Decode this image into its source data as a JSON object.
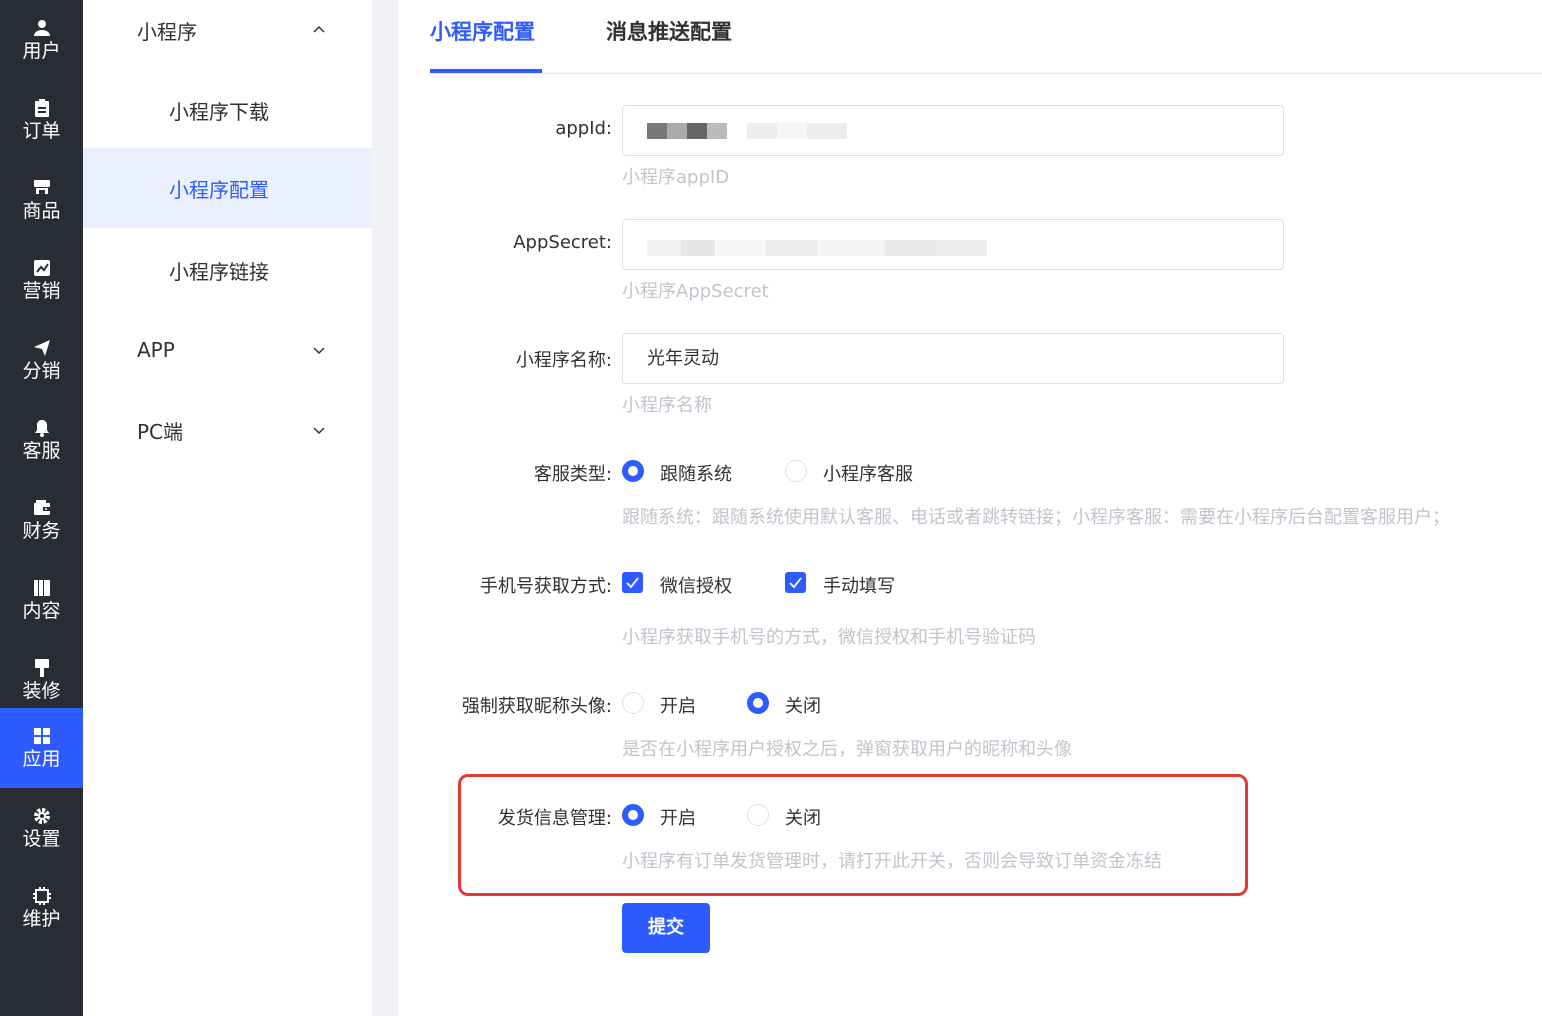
{
  "rail": {
    "items": [
      {
        "label": "用户",
        "icon": "user-icon"
      },
      {
        "label": "订单",
        "icon": "clipboard-icon"
      },
      {
        "label": "商品",
        "icon": "store-icon"
      },
      {
        "label": "营销",
        "icon": "chart-icon"
      },
      {
        "label": "分销",
        "icon": "send-icon"
      },
      {
        "label": "客服",
        "icon": "bell-icon"
      },
      {
        "label": "财务",
        "icon": "wallet-icon"
      },
      {
        "label": "内容",
        "icon": "book-icon"
      },
      {
        "label": "装修",
        "icon": "brush-icon"
      },
      {
        "label": "应用",
        "icon": "apps-icon"
      },
      {
        "label": "设置",
        "icon": "gear-icon"
      },
      {
        "label": "维护",
        "icon": "chip-icon"
      }
    ],
    "active": "应用"
  },
  "submenu": {
    "group_miniprogram": "小程序",
    "item_download": "小程序下载",
    "item_config": "小程序配置",
    "item_link": "小程序链接",
    "group_app": "APP",
    "group_pc": "PC端"
  },
  "tabs": {
    "config": "小程序配置",
    "push": "消息推送配置"
  },
  "form": {
    "appid_label": "appId:",
    "appid_hint": "小程序appID",
    "secret_label": "AppSecret:",
    "secret_hint": "小程序AppSecret",
    "name_label": "小程序名称:",
    "name_value": "光年灵动",
    "name_hint": "小程序名称",
    "service_label": "客服类型:",
    "service_opt1": "跟随系统",
    "service_opt2": "小程序客服",
    "service_hint": "跟随系统：跟随系统使用默认客服、电话或者跳转链接；小程序客服：需要在小程序后台配置客服用户；",
    "phone_label": "手机号获取方式:",
    "phone_opt1": "微信授权",
    "phone_opt2": "手动填写",
    "phone_hint": "小程序获取手机号的方式，微信授权和手机号验证码",
    "avatar_label": "强制获取昵称头像:",
    "avatar_opt1": "开启",
    "avatar_opt2": "关闭",
    "avatar_hint": "是否在小程序用户授权之后，弹窗获取用户的昵称和头像",
    "ship_label": "发货信息管理:",
    "ship_opt1": "开启",
    "ship_opt2": "关闭",
    "ship_hint": "小程序有订单发货管理时，请打开此开关，否则会导致订单资金冻结",
    "submit": "提交"
  },
  "colors": {
    "accent": "#2d5bff",
    "rail_bg": "#282c34",
    "highlight": "#e53935"
  }
}
